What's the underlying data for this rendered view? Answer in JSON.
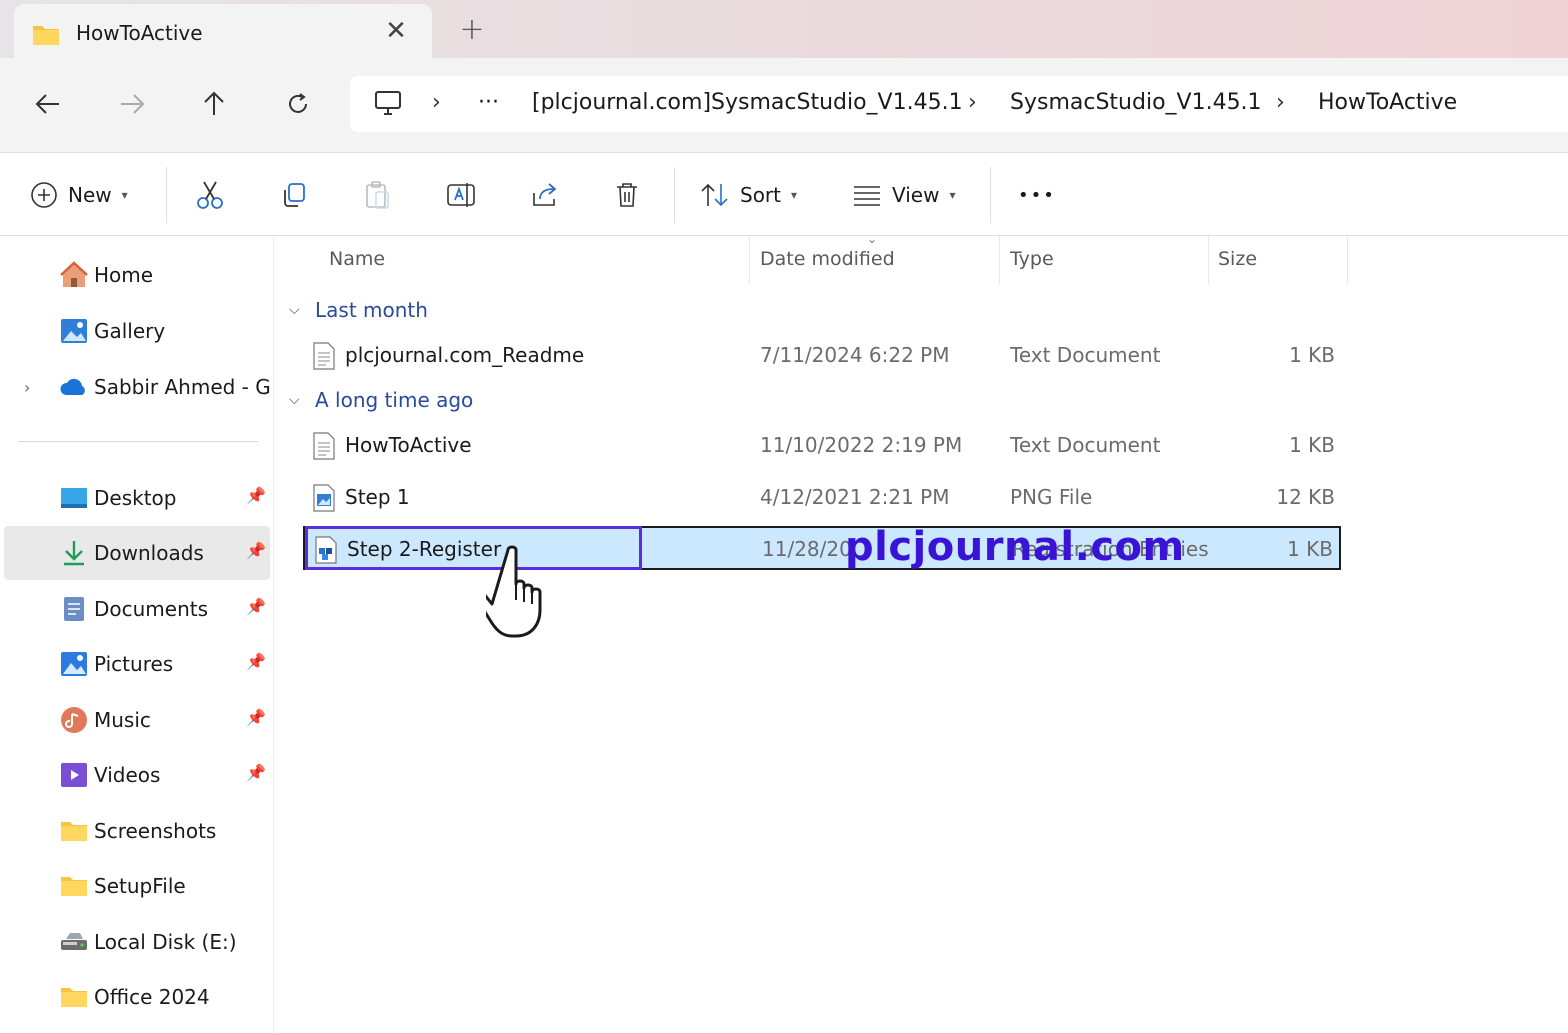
{
  "tab": {
    "title": "HowToActive",
    "close": "✕",
    "new_tab": "+"
  },
  "address": {
    "more": "···",
    "crumbs": [
      "[plcjournal.com]SysmacStudio_V1.45.1",
      "SysmacStudio_V1.45.1",
      "HowToActive"
    ],
    "separator": "›"
  },
  "toolbar": {
    "new_label": "New",
    "sort_label": "Sort",
    "view_label": "View",
    "more_label": "•••"
  },
  "sidebar": {
    "top": [
      {
        "label": "Home"
      },
      {
        "label": "Gallery"
      },
      {
        "label": "Sabbir Ahmed - Glo"
      }
    ],
    "pinned": [
      {
        "label": "Desktop"
      },
      {
        "label": "Downloads"
      },
      {
        "label": "Documents"
      },
      {
        "label": "Pictures"
      },
      {
        "label": "Music"
      },
      {
        "label": "Videos"
      },
      {
        "label": "Screenshots"
      },
      {
        "label": "SetupFile"
      },
      {
        "label": "Local Disk (E:)"
      },
      {
        "label": "Office 2024"
      }
    ]
  },
  "columns": {
    "name": "Name",
    "date": "Date modified",
    "type": "Type",
    "size": "Size"
  },
  "groups": [
    {
      "label": "Last month"
    },
    {
      "label": "A long time ago"
    }
  ],
  "files": [
    {
      "name": "plcjournal.com_Readme",
      "date": "7/11/2024 6:22 PM",
      "type": "Text Document",
      "size": "1 KB"
    },
    {
      "name": "HowToActive",
      "date": "11/10/2022 2:19 PM",
      "type": "Text Document",
      "size": "1 KB"
    },
    {
      "name": "Step 1",
      "date": "4/12/2021 2:21 PM",
      "type": "PNG File",
      "size": "12 KB"
    },
    {
      "name": "Step 2-Register",
      "date": "11/28/20",
      "type": "Registration Entries",
      "size": "1 KB"
    }
  ],
  "watermark": "plcjournal.com",
  "colors": {
    "accent": "#2a4a9e",
    "selection": "#cce8ff",
    "highlight_box": "#5b2fe0",
    "watermark": "#3a14d6"
  }
}
